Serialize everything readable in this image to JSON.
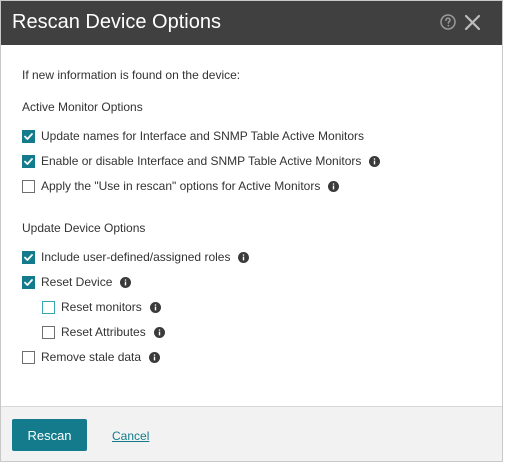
{
  "dialog": {
    "title": "Rescan Device Options",
    "icons": {
      "help": "help-circle-icon",
      "close": "close-icon"
    }
  },
  "content": {
    "intro": "If new information is found on the device:",
    "active_monitor": {
      "title": "Active Monitor Options",
      "options": [
        {
          "label": "Update names for Interface and SNMP Table Active Monitors",
          "checked": true,
          "info": false
        },
        {
          "label": "Enable or disable Interface and SNMP Table Active Monitors",
          "checked": true,
          "info": true
        },
        {
          "label": "Apply the \"Use in rescan\" options for Active Monitors",
          "checked": false,
          "info": true
        }
      ]
    },
    "update_device": {
      "title": "Update Device Options",
      "options": [
        {
          "label": "Include user-defined/assigned roles",
          "checked": true,
          "info": true
        },
        {
          "label": "Reset Device",
          "checked": true,
          "info": true
        },
        {
          "label": "Reset monitors",
          "checked": false,
          "info": true
        },
        {
          "label": "Reset Attributes",
          "checked": false,
          "info": true
        },
        {
          "label": "Remove stale data",
          "checked": false,
          "info": true
        }
      ]
    }
  },
  "footer": {
    "rescan_label": "Rescan",
    "cancel_label": "Cancel"
  },
  "colors": {
    "titlebar": "#404040",
    "accent": "#137b8c",
    "footer": "#f2f2f2"
  }
}
